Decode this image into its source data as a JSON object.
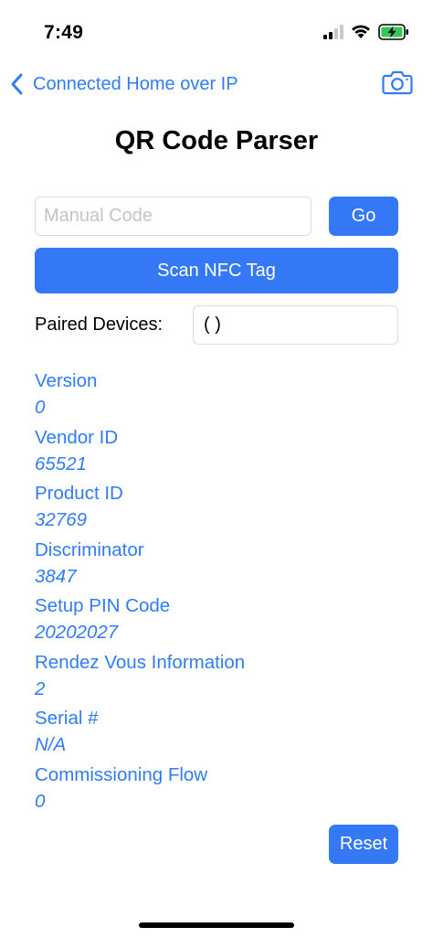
{
  "status_bar": {
    "time": "7:49"
  },
  "nav": {
    "back_label": "Connected Home over IP"
  },
  "title": "QR Code Parser",
  "manual_code": {
    "placeholder": "Manual Code",
    "value": "",
    "go_label": "Go"
  },
  "scan_nfc_label": "Scan NFC Tag",
  "paired_devices": {
    "label": "Paired Devices:",
    "value": "( )"
  },
  "info": [
    {
      "label": "Version",
      "value": "0"
    },
    {
      "label": "Vendor ID",
      "value": "65521"
    },
    {
      "label": "Product ID",
      "value": "32769"
    },
    {
      "label": "Discriminator",
      "value": "3847"
    },
    {
      "label": "Setup PIN Code",
      "value": "20202027"
    },
    {
      "label": "Rendez Vous Information",
      "value": "2"
    },
    {
      "label": "Serial #",
      "value": "N/A"
    },
    {
      "label": "Commissioning Flow",
      "value": "0"
    }
  ],
  "reset_label": "Reset",
  "colors": {
    "accent": "#3478f6",
    "link": "#2f7cf6",
    "battery_charging": "#34c759"
  },
  "icons": [
    "signal-icon",
    "wifi-icon",
    "battery-charging-icon",
    "back-chevron-icon",
    "camera-icon"
  ]
}
